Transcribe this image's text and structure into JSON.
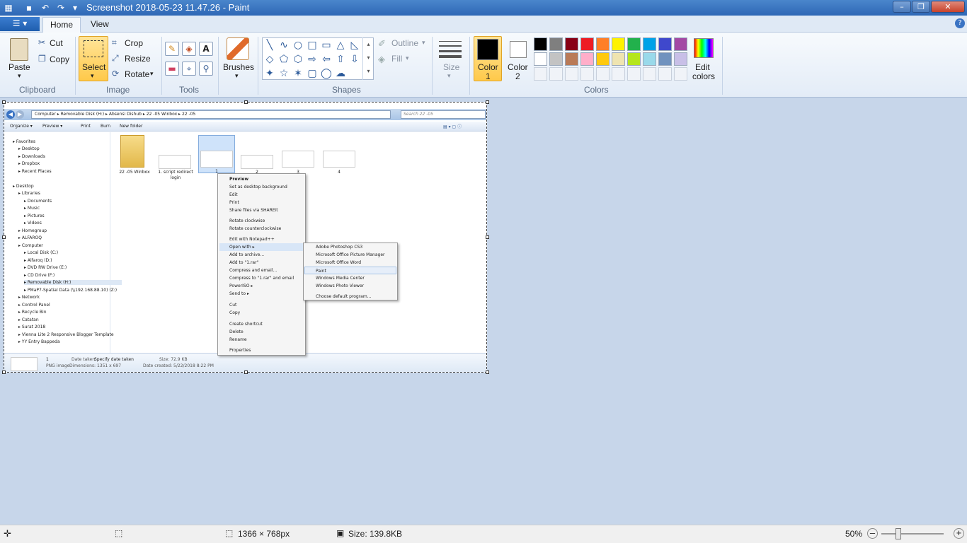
{
  "window": {
    "title": "Screenshot 2018-05-23 11.47.26 - Paint"
  },
  "tabs": {
    "home": "Home",
    "view": "View"
  },
  "clipboard": {
    "paste": "Paste",
    "cut": "Cut",
    "copy": "Copy",
    "label": "Clipboard"
  },
  "image": {
    "select": "Select",
    "crop": "Crop",
    "resize": "Resize",
    "rotate": "Rotate",
    "label": "Image"
  },
  "tools": {
    "label": "Tools"
  },
  "brushes": {
    "label": "Brushes"
  },
  "shapes": {
    "outline": "Outline",
    "fill": "Fill",
    "label": "Shapes"
  },
  "size": {
    "label": "Size"
  },
  "colors": {
    "color1": "Color",
    "color1n": "1",
    "color2": "Color",
    "color2n": "2",
    "edit1": "Edit",
    "edit2": "colors",
    "label": "Colors",
    "palette": [
      "#000000",
      "#7f7f7f",
      "#880015",
      "#ed1c24",
      "#ff7f27",
      "#fff200",
      "#22b14c",
      "#00a2e8",
      "#3f48cc",
      "#a349a4",
      "#ffffff",
      "#c3c3c3",
      "#b97a57",
      "#ffaec9",
      "#ffc90e",
      "#efe4b0",
      "#b5e61d",
      "#99d9ea",
      "#7092be",
      "#c8bfe7"
    ]
  },
  "status": {
    "dimensions": "1366 × 768px",
    "size": "Size: 139.8KB",
    "zoom": "50%"
  },
  "explorer": {
    "address": "Computer ▸ Removable Disk (H:) ▸ Absensi Dishub ▸ 22 -05 Winbox ▸ 22 -05",
    "search": "Search 22 -05",
    "toolbar": [
      "Organize ▾",
      "Preview ▾",
      "Print",
      "Burn",
      "New folder"
    ],
    "nav": [
      "Favorites",
      "Desktop",
      "Downloads",
      "Dropbox",
      "Recent Places",
      "",
      "Desktop",
      "Libraries",
      "Documents",
      "Music",
      "Pictures",
      "Videos",
      "Homegroup",
      "ALFAROQ",
      "Computer",
      "Local Disk (C:)",
      "Alfaroq (D:)",
      "DVD RW Drive (E:)",
      "CD Drive (F:)",
      "Removable Disk (H:)",
      "PMaP7-Spatial Data (\\\\192.168.88.10) (Z:)",
      "Network",
      "Control Panel",
      "Recycle Bin",
      "Catatan",
      "Surat 2018",
      "Vienna Lite 2 Responsive Blogger Template",
      "YY Entry Bappeda"
    ],
    "files": [
      "22 -05 Winbox",
      "1. script redirect login",
      "1",
      "2",
      "3",
      "4"
    ],
    "details": {
      "name": "1",
      "type": "PNG image",
      "date_taken": "Date taken:",
      "date_taken_val": "Specify date taken",
      "dims": "Dimensions: 1351 x 697",
      "fsize": "Size: 72.9 KB",
      "created": "Date created: 5/22/2018 8:22 PM"
    },
    "menu": [
      "Preview",
      "Set as desktop background",
      "Edit",
      "Print",
      "Share files via SHAREit",
      "Rotate clockwise",
      "Rotate counterclockwise",
      "Edit with Notepad++",
      "Open with",
      "Add to archive...",
      "Add to \"1.rar\"",
      "Compress and email...",
      "Compress to \"1.rar\" and email",
      "PowerISO",
      "Send to",
      "Cut",
      "Copy",
      "Create shortcut",
      "Delete",
      "Rename",
      "Properties"
    ],
    "submenu": [
      "Adobe Photoshop CS3",
      "Microsoft Office Picture Manager",
      "Microsoft Office Word",
      "Paint",
      "Windows Media Center",
      "Windows Photo Viewer",
      "Choose default program..."
    ]
  }
}
